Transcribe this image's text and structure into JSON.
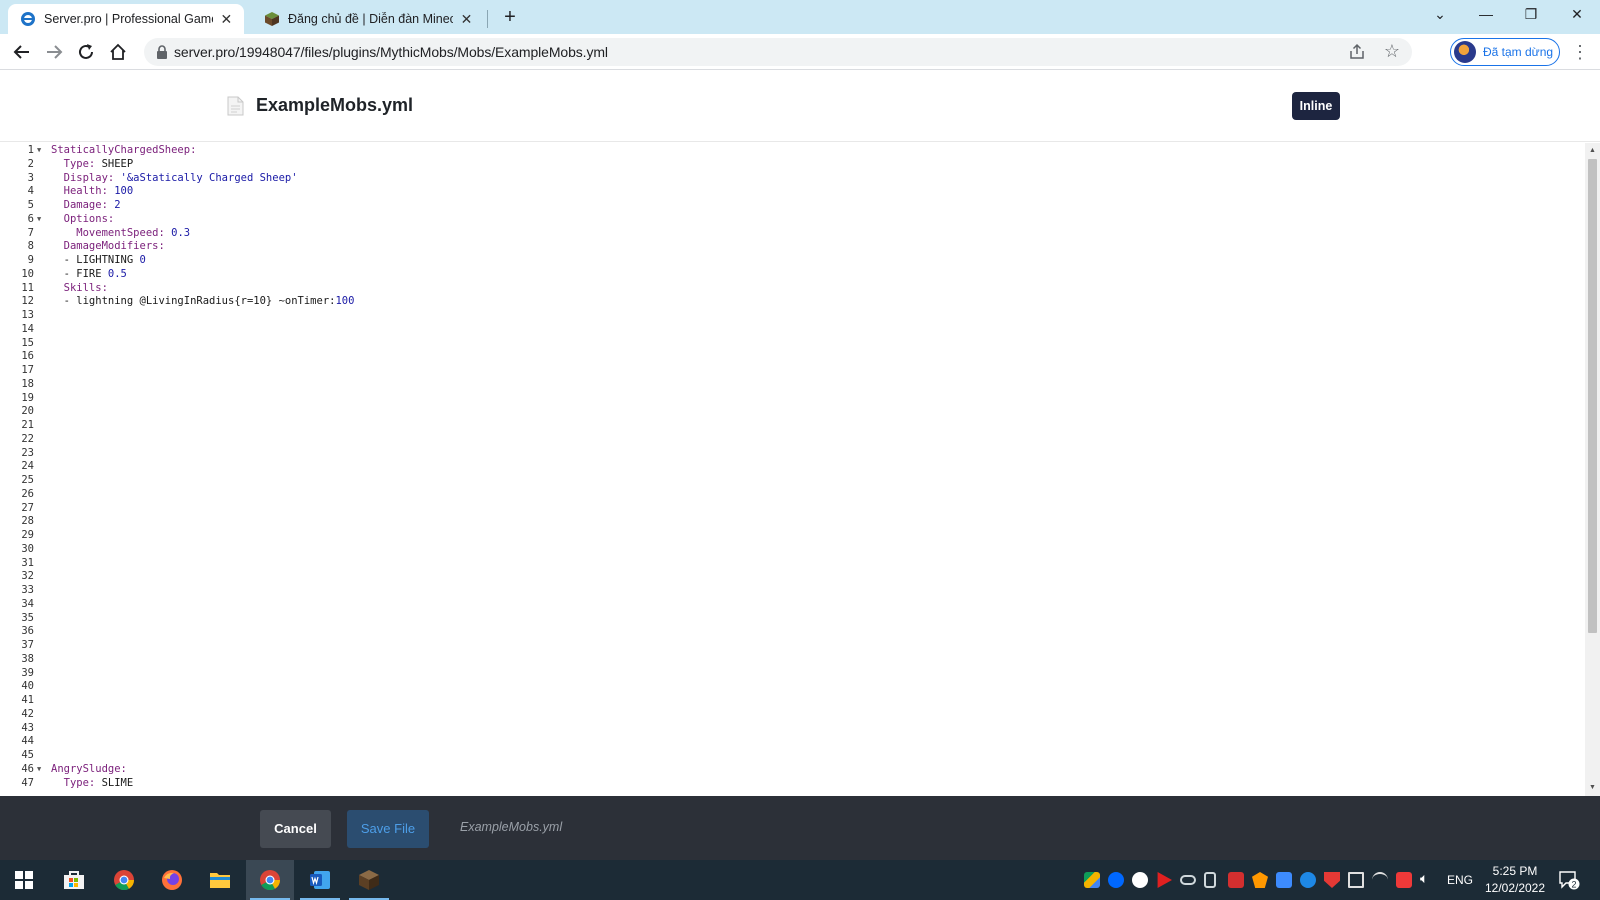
{
  "browser": {
    "tabs": [
      {
        "title": "Server.pro | Professional Game Server Hosting",
        "active": true,
        "icon": "serverpro-favicon"
      },
      {
        "title": "Đăng chủ đề | Diễn đàn Minecraft",
        "active": false,
        "icon": "minecraft-block-favicon"
      }
    ],
    "url": "server.pro/19948047/files/plugins/MythicMobs/Mobs/ExampleMobs.yml",
    "profile_label": "Đã tạm dừng"
  },
  "page": {
    "file_title": "ExampleMobs.yml",
    "mode_button": "Inline"
  },
  "editor": {
    "line_numbers": [
      "1",
      "2",
      "3",
      "4",
      "5",
      "6",
      "7",
      "8",
      "9",
      "10",
      "11",
      "12",
      "13",
      "14",
      "15",
      "16",
      "17",
      "18",
      "19",
      "20",
      "21",
      "22",
      "23",
      "24",
      "25",
      "26",
      "27",
      "28",
      "29",
      "30",
      "31",
      "32",
      "33",
      "34",
      "35",
      "36",
      "37",
      "38",
      "39",
      "40",
      "41",
      "42",
      "43",
      "44",
      "45",
      "46",
      "47"
    ],
    "fold_lines": [
      "1",
      "6",
      "46"
    ],
    "lines": [
      {
        "ln": 1,
        "parts": [
          {
            "t": "k",
            "text": "StaticallyChargedSheep:"
          }
        ]
      },
      {
        "ln": 2,
        "parts": [
          {
            "t": "k",
            "text": "  Type:"
          },
          {
            "t": "v",
            "text": " SHEEP"
          }
        ]
      },
      {
        "ln": 3,
        "parts": [
          {
            "t": "k",
            "text": "  Display:"
          },
          {
            "t": "s",
            "text": " '&aStatically Charged Sheep'"
          }
        ]
      },
      {
        "ln": 4,
        "parts": [
          {
            "t": "k",
            "text": "  Health:"
          },
          {
            "t": "n",
            "text": " 100"
          }
        ]
      },
      {
        "ln": 5,
        "parts": [
          {
            "t": "k",
            "text": "  Damage:"
          },
          {
            "t": "n",
            "text": " 2"
          }
        ]
      },
      {
        "ln": 6,
        "parts": [
          {
            "t": "k",
            "text": "  Options:"
          }
        ]
      },
      {
        "ln": 7,
        "parts": [
          {
            "t": "k",
            "text": "    MovementSpeed:"
          },
          {
            "t": "n",
            "text": " 0.3"
          }
        ]
      },
      {
        "ln": 8,
        "parts": [
          {
            "t": "k",
            "text": "  DamageModifiers:"
          }
        ]
      },
      {
        "ln": 9,
        "parts": [
          {
            "t": "p",
            "text": "  - LIGHTNING "
          },
          {
            "t": "n",
            "text": "0"
          }
        ]
      },
      {
        "ln": 10,
        "parts": [
          {
            "t": "p",
            "text": "  - FIRE "
          },
          {
            "t": "n",
            "text": "0.5"
          }
        ]
      },
      {
        "ln": 11,
        "parts": [
          {
            "t": "k",
            "text": "  Skills:"
          }
        ]
      },
      {
        "ln": 12,
        "parts": [
          {
            "t": "p",
            "text": "  - lightning @LivingInRadius{r=10} ~onTimer:"
          },
          {
            "t": "n",
            "text": "100"
          }
        ]
      },
      {
        "ln": 46,
        "parts": [
          {
            "t": "k",
            "text": "AngrySludge:"
          }
        ]
      },
      {
        "ln": 47,
        "parts": [
          {
            "t": "k",
            "text": "  Type:"
          },
          {
            "t": "v",
            "text": " SLIME"
          }
        ]
      }
    ]
  },
  "footer": {
    "cancel_label": "Cancel",
    "save_label": "Save File",
    "filename": "ExampleMobs.yml"
  },
  "taskbar": {
    "apps": [
      "windows-start-icon",
      "microsoft-store-icon",
      "chrome-icon",
      "firefox-icon",
      "file-explorer-icon",
      "chrome-active-icon",
      "word-icon",
      "minecraft-icon"
    ],
    "language": "ENG",
    "time": "5:25 PM",
    "date": "12/02/2022",
    "notification_count": "2"
  },
  "colors": {
    "tabstrip": "#cce8f4",
    "footer": "#2c3038",
    "inline_button": "#1d2540",
    "yaml_key": "#7a1e7a",
    "yaml_value": "#1a1aa6",
    "taskbar": "#1c2b36"
  }
}
